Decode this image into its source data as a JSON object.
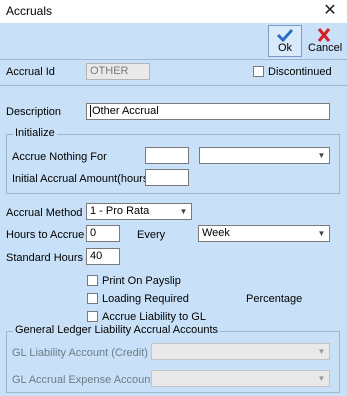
{
  "window": {
    "title": "Accruals",
    "close_glyph": "✕"
  },
  "toolbar": {
    "ok_label": "Ok",
    "cancel_label": "Cancel",
    "ok_icon": "checkmark-icon",
    "cancel_icon": "red-x-icon"
  },
  "header": {
    "accrual_id_label": "Accrual Id",
    "accrual_id_value": "OTHER",
    "discontinued_label": "Discontinued",
    "discontinued_checked": false
  },
  "description": {
    "label": "Description",
    "value": "Other Accrual"
  },
  "initialize": {
    "title": "Initialize",
    "accrue_nothing_for_label": "Accrue Nothing For",
    "accrue_nothing_for_value": "",
    "accrue_nothing_for_unit": "",
    "initial_accrual_label": "Initial Accrual Amount(hours)",
    "initial_accrual_value": ""
  },
  "method": {
    "label": "Accrual Method",
    "value": "1 - Pro Rata",
    "hours_label": "Hours to Accrue",
    "hours_value": "0",
    "every_label": "Every",
    "every_value": "Week",
    "standard_label": "Standard Hours",
    "standard_value": "40"
  },
  "options": {
    "print_on_payslip": "Print On Payslip",
    "loading_required": "Loading Required",
    "percentage_label": "Percentage",
    "accrue_liability": "Accrue Liability to GL"
  },
  "gl": {
    "title": "General Ledger Liability Accrual Accounts",
    "liability_label": "GL Liability Account (Credit)",
    "liability_value": "",
    "expense_label": "GL Accrual Expense Account",
    "expense_value": ""
  },
  "colors": {
    "panel": "#c8e1f8",
    "ok_check": "#2a6fc4",
    "cancel_x": "#d42020"
  }
}
